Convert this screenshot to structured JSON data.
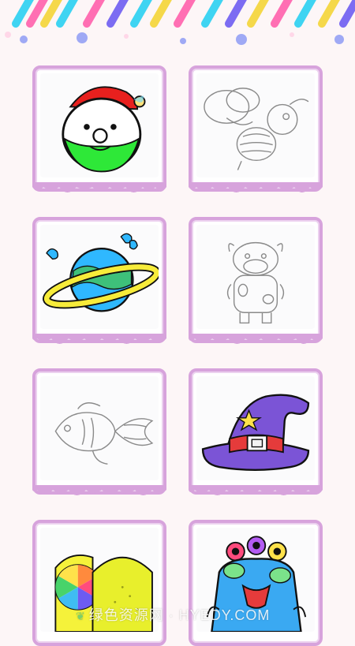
{
  "cards": [
    {
      "subject": "santa-face",
      "state": "colored"
    },
    {
      "subject": "bee",
      "state": "outline"
    },
    {
      "subject": "planet",
      "state": "colored"
    },
    {
      "subject": "cow",
      "state": "outline"
    },
    {
      "subject": "fish",
      "state": "outline"
    },
    {
      "subject": "witch-hat",
      "state": "colored"
    },
    {
      "subject": "lemon",
      "state": "colored"
    },
    {
      "subject": "alien-monster",
      "state": "colored"
    }
  ],
  "watermark": {
    "text": "绿色资源网 · HYEDY.COM"
  },
  "colors": {
    "frame": "#d7a3dc",
    "background": "#fdf6f7",
    "banner_stripes": [
      "#3fd4f2",
      "#f5d84a",
      "#ff6fb3",
      "#7c6cf2",
      "#ffffff"
    ]
  }
}
